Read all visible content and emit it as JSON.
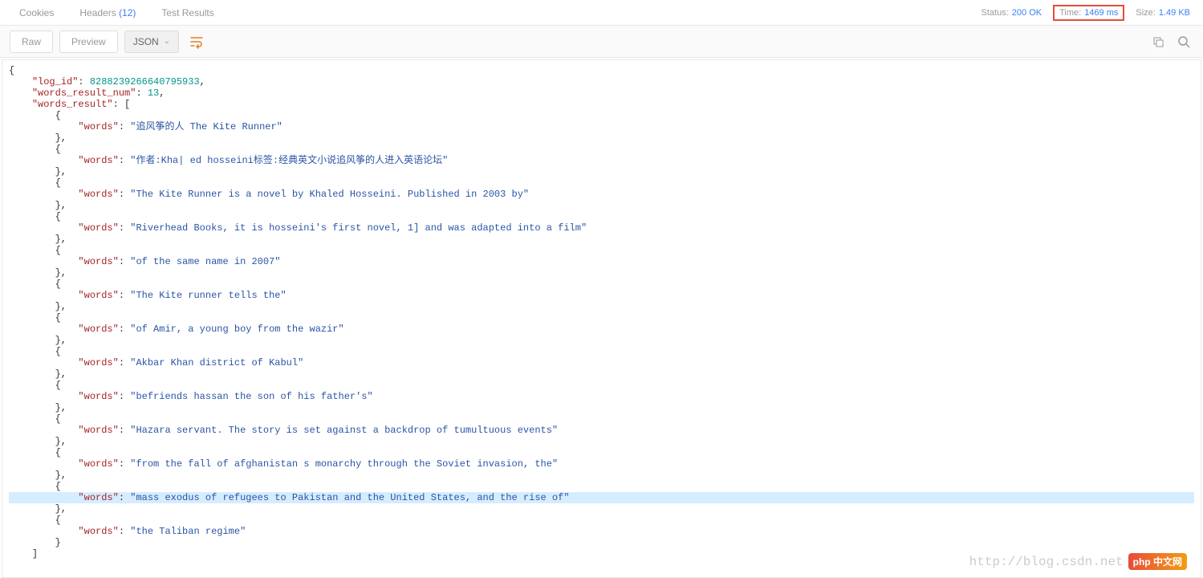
{
  "tabs": {
    "cookies": "Cookies",
    "headers": "Headers",
    "headers_count": "(12)",
    "test_results": "Test Results"
  },
  "status": {
    "status_label": "Status:",
    "status_value": "200 OK",
    "time_label": "Time:",
    "time_value": "1469 ms",
    "size_label": "Size:",
    "size_value": "1.49 KB"
  },
  "toolbar": {
    "raw": "Raw",
    "preview": "Preview",
    "json": "JSON"
  },
  "json": {
    "log_id_key": "\"log_id\"",
    "log_id_val": "8288239266640795933",
    "num_key": "\"words_result_num\"",
    "num_val": "13",
    "result_key": "\"words_result\"",
    "words_key": "\"words\"",
    "items": [
      "\"追风筝的人 The Kite Runner\"",
      "\"作者:Kha| ed hosseini标签:经典英文小说追风筝的人进入英语论坛\"",
      "\"The Kite Runner is a novel by Khaled Hosseini. Published in 2003 by\"",
      "\"Riverhead Books, it is hosseini's first novel, 1] and was adapted into a film\"",
      "\"of the same name in 2007\"",
      "\"The Kite runner tells the\"",
      "\"of Amir, a young boy from the wazir\"",
      "\"Akbar Khan district of Kabul\"",
      "\"befriends hassan the son of his father's\"",
      "\"Hazara servant. The story is set against a backdrop of tumultuous events\"",
      "\"from the fall of afghanistan s monarchy through the Soviet invasion, the\"",
      "\"mass exodus of refugees to Pakistan and the United States, and the rise of\"",
      "\"the Taliban regime\""
    ],
    "highlight_index": 11
  },
  "watermark": {
    "url": "http://blog.csdn.net",
    "badge1": "php",
    "badge2": "中文网"
  }
}
